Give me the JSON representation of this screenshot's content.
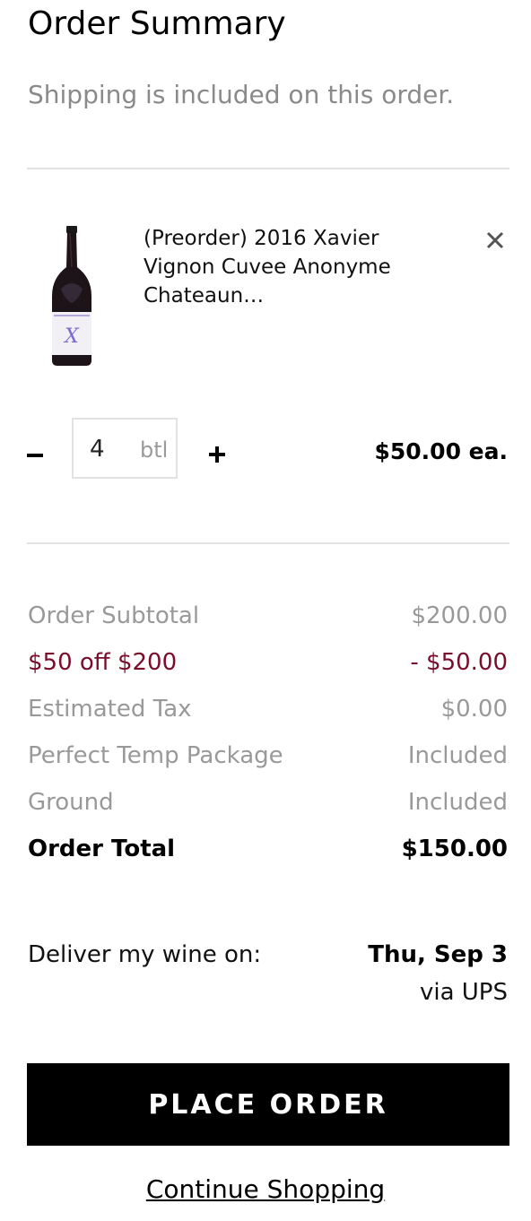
{
  "header": {
    "title": "Order Summary",
    "subtitle": "Shipping is included on this order."
  },
  "item": {
    "name": "(Preorder) 2016 Xavier Vignon Cuvee Anonyme Chateaun…",
    "remove_icon": "close-icon",
    "quantity": "4",
    "unit": "btl",
    "price_each": "$50.00 ea.",
    "image": "wine-bottle-image"
  },
  "summary": {
    "rows": [
      {
        "label": "Order Subtotal",
        "value": "$200.00"
      },
      {
        "label": "$50 off $200",
        "value": "- $50.00"
      },
      {
        "label": "Estimated Tax",
        "value": "$0.00"
      },
      {
        "label": "Perfect Temp Package",
        "value": "Included"
      },
      {
        "label": "Ground",
        "value": "Included"
      },
      {
        "label": "Order Total",
        "value": "$150.00"
      }
    ]
  },
  "delivery": {
    "label": "Deliver my wine on:",
    "date": "Thu, Sep 3",
    "carrier": "via UPS"
  },
  "actions": {
    "place_order": "PLACE ORDER",
    "continue": "Continue Shopping"
  },
  "colors": {
    "promo": "#7a0d2c",
    "muted": "#999999",
    "button_bg": "#000000"
  }
}
